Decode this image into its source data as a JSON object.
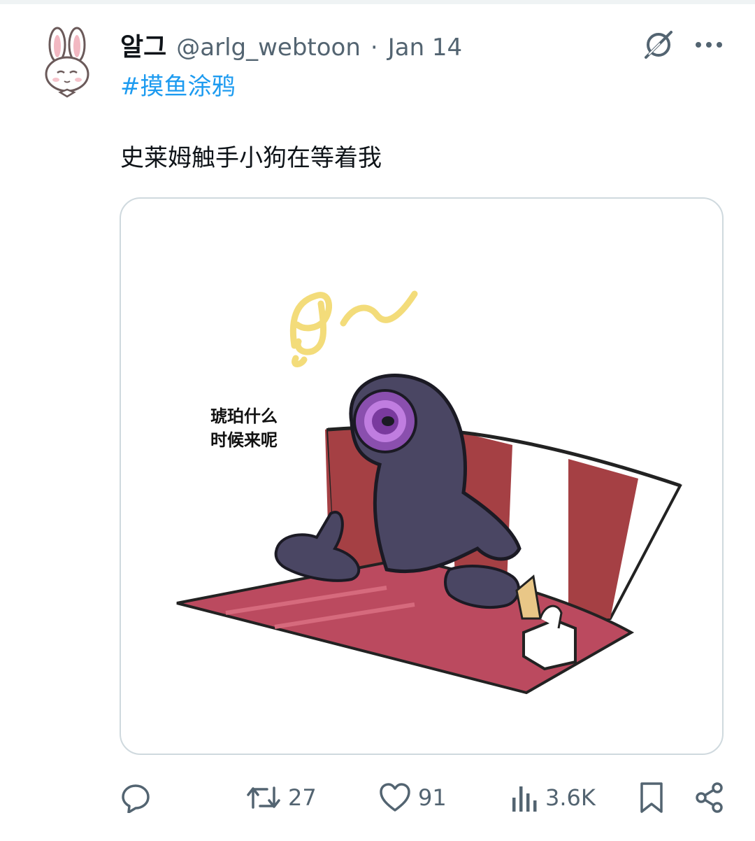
{
  "tweet": {
    "author_name": "알그",
    "author_handle": "@arlg_webtoon",
    "separator": "·",
    "date": "Jan 14",
    "hashtag": "#摸鱼涂鸦",
    "text": "史莱姆触手小狗在等着我"
  },
  "media": {
    "speech_line1": "琥珀什么",
    "speech_line2": "时候来呢",
    "music_scribble": "♬~"
  },
  "actions": {
    "reply_icon": "reply-bubble-icon",
    "retweet_icon": "retweet-icon",
    "retweet_count": "27",
    "like_icon": "heart-icon",
    "like_count": "91",
    "views_icon": "bar-chart-icon",
    "views_count": "3.6K",
    "bookmark_icon": "bookmark-icon",
    "share_icon": "share-icon"
  },
  "colors": {
    "link": "#1d9bf0",
    "secondary_text": "#536471",
    "primary_text": "#0f1419",
    "card_border": "#cfd9de"
  }
}
